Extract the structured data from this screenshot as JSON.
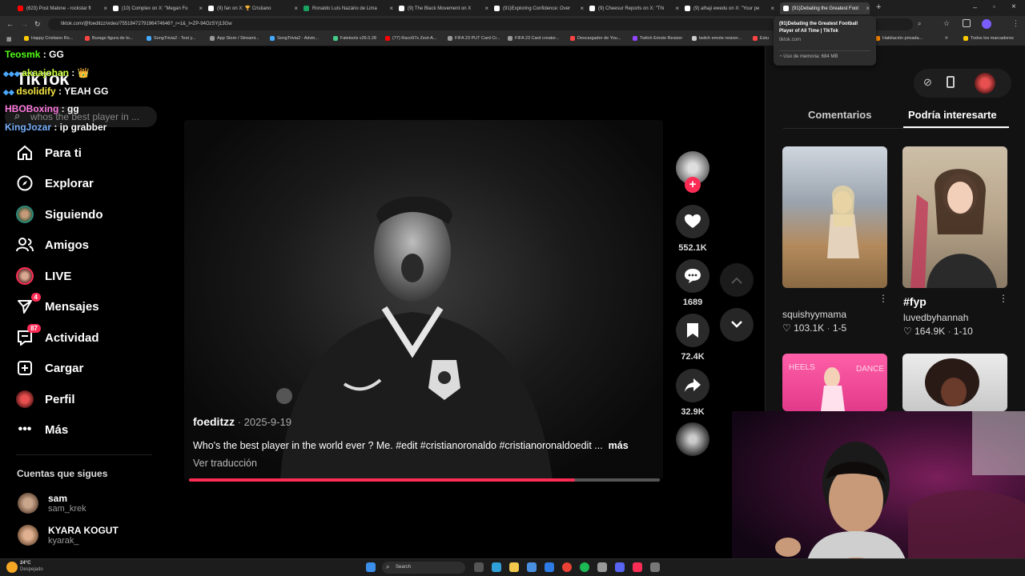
{
  "browser": {
    "tabs": [
      {
        "label": "(623) Post Malone - rockstar ft",
        "color": "#ff0000"
      },
      {
        "label": "(10) Complex on X: \"Megan Fo",
        "color": "#ffffff"
      },
      {
        "label": "(9) fan on X: 🏆 Cristiano",
        "color": "#ffffff"
      },
      {
        "label": "Ronaldo Luís Nazário de Lima",
        "color": "#1aa260"
      },
      {
        "label": "(9) The Black Movement on X",
        "color": "#ffffff"
      },
      {
        "label": "(91)Exploring Confidence: Over",
        "color": "#ffffff"
      },
      {
        "label": "(9) Cheesur Reports on X: \"Thi",
        "color": "#ffffff"
      },
      {
        "label": "(9) alhaji ewedu on X: \"Your pe",
        "color": "#ffffff"
      },
      {
        "label": "(91)Debating the Greatest Foot",
        "color": "#ffffff"
      }
    ],
    "url": "tiktok.com/@foeditzz/video/7551847279196474646?_r=1&_t=ZP-94OzSYj13Gw",
    "bookmarks": [
      {
        "label": "Happy Cristiano Ro...",
        "color": "#ffcc00"
      },
      {
        "label": "Burago figura de to...",
        "color": "#ff4444"
      },
      {
        "label": "SongTrivia2 - Test y...",
        "color": "#44aaff"
      },
      {
        "label": "App Store / Streami...",
        "color": "#999999"
      },
      {
        "label": "SongTrivia2 - Advin...",
        "color": "#44aaff"
      },
      {
        "label": "Faletools v26.0.28",
        "color": "#44cc88"
      },
      {
        "label": "(77) Raco97s Zest-A...",
        "color": "#ff0000"
      },
      {
        "label": "FIFA 23 PUT Card Cr...",
        "color": "#999999"
      },
      {
        "label": "FIFA 23 Card creator...",
        "color": "#999999"
      },
      {
        "label": "Descargador de You...",
        "color": "#ff4444"
      },
      {
        "label": "Twitch Emote Resizer",
        "color": "#9146ff"
      },
      {
        "label": "twitch emote resizer...",
        "color": "#cccccc"
      },
      {
        "label": "Estu",
        "color": "#ff4444"
      },
      {
        "label": "Habitación privada...",
        "color": "#ff8800"
      },
      {
        "label": "Todos los marcadores",
        "color": "#ffcc00"
      }
    ],
    "tooltip": {
      "title": "(91)Debating the Greatest Football Player of All Time | TikTok",
      "domain": "tiktok.com",
      "memory": "Uso de memoria: 684 MB"
    }
  },
  "tiktok": {
    "logo": "TikTok",
    "search_placeholder": "whos the best player in ...",
    "nav": [
      {
        "label": "Para ti",
        "icon": "home-icon"
      },
      {
        "label": "Explorar",
        "icon": "compass-icon"
      },
      {
        "label": "Siguiendo",
        "icon": "avatar-icon"
      },
      {
        "label": "Amigos",
        "icon": "friends-icon"
      },
      {
        "label": "LIVE",
        "icon": "live-icon"
      },
      {
        "label": "Mensajes",
        "icon": "send-icon",
        "badge": "4"
      },
      {
        "label": "Actividad",
        "icon": "activity-icon",
        "badge": "87"
      },
      {
        "label": "Cargar",
        "icon": "upload-icon"
      },
      {
        "label": "Perfil",
        "icon": "profile-icon"
      },
      {
        "label": "Más",
        "icon": "more-icon"
      }
    ],
    "following_header": "Cuentas que sigues",
    "following": [
      {
        "name": "sam",
        "user": "sam_krek"
      },
      {
        "name": "KYARA KOGUT",
        "user": "kyarak_"
      }
    ],
    "video": {
      "author": "foeditzz",
      "date": "2025-9-19",
      "caption": "Who's the best player in the world ever ? Me. #edit #cristianoronaldo #cristianoronaldoedit ...",
      "more": "más",
      "translate": "Ver traducción",
      "progress": 0.82
    },
    "actions": {
      "likes": "552.1K",
      "comments": "1689",
      "saves": "72.4K",
      "shares": "32.9K"
    },
    "panel": {
      "tab_comments": "Comentarios",
      "tab_recommend": "Podría interesarte",
      "items": [
        {
          "title": "squishyymama",
          "likes": "103.1K",
          "pos": "1-5"
        },
        {
          "title": "#fyp",
          "author": "luvedbyhannah",
          "likes": "164.9K",
          "pos": "1-10"
        }
      ]
    }
  },
  "chat": [
    {
      "name": "Teosmk",
      "msg": " : GG"
    },
    {
      "name": "akaajohan",
      "msg": " : 👑"
    },
    {
      "name": "dsolidify",
      "msg": " : YEAH GG"
    },
    {
      "name": "HBOBoxing",
      "msg": " : gg"
    },
    {
      "name": "KingJozar",
      "msg": " : ip grabber"
    }
  ],
  "taskbar": {
    "weather_temp": "24°C",
    "weather_text": "Despejado",
    "search": "Search"
  }
}
